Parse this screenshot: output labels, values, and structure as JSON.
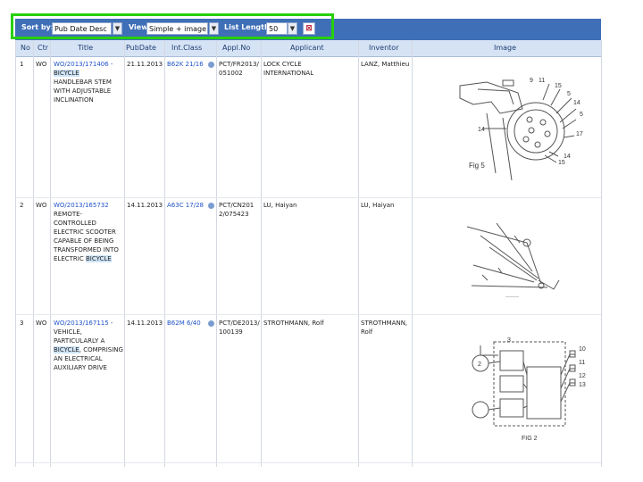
{
  "toolbar": {
    "sort_label": "Sort by:",
    "sort_value": "Pub Date Desc",
    "view_label": "View",
    "view_value": "Simple + image",
    "list_length_label": "List Length",
    "list_length_value": "50"
  },
  "columns": {
    "no": "No",
    "ctr": "Ctr",
    "title": "Title",
    "pubdate": "PubDate",
    "intclass": "Int.Class",
    "applno": "Appl.No",
    "applicant": "Applicant",
    "inventor": "Inventor",
    "image": "Image"
  },
  "rows": [
    {
      "no": "1",
      "ctr": "WO",
      "title_link": "WO/2013/171406 -",
      "title_keyword": "BICYCLE",
      "title_text": "HANDLEBAR STEM WITH ADJUSTABLE INCLINATION",
      "pubdate": "21.11.2013",
      "intclass": "B62K 21/16",
      "applno": "PCT/FR2013/051002",
      "applicant": "LOCK CYCLE INTERNATIONAL",
      "inventor": "LANZ, Matthieu",
      "image_caption": "Fig 5",
      "image_labels": [
        "9",
        "11",
        "15",
        "5",
        "14",
        "5",
        "17",
        "14",
        "14",
        "15"
      ]
    },
    {
      "no": "2",
      "ctr": "WO",
      "title_link": "WO/2013/165732",
      "title_text": "REMOTE-CONTROLLED ELECTRIC SCOOTER CAPABLE OF BEING TRANSFORMED INTO ELECTRIC",
      "title_keyword": "BICYCLE",
      "pubdate": "14.11.2013",
      "intclass": "A63C 17/28",
      "applno": "PCT/CN2012/075423",
      "applicant": "LU, Haiyan",
      "inventor": "LU, Haiyan"
    },
    {
      "no": "3",
      "ctr": "WO",
      "title_link": "WO/2013/167115 -",
      "title_text_pre": "VEHICLE, PARTICULARLY A",
      "title_keyword": "BICYCLE",
      "title_text": ", COMPRISING AN ELECTRICAL AUXILIARY DRIVE",
      "pubdate": "14.11.2013",
      "intclass": "B62M 6/40",
      "applno": "PCT/DE2013/100139",
      "applicant": "STROTHMANN, Rolf",
      "inventor": "STROTHMANN, Rolf",
      "image_caption": "FIG 2",
      "image_labels": [
        "3",
        "2",
        "10",
        "11",
        "12",
        "13"
      ]
    }
  ],
  "icons": {
    "filter": "filter-icon",
    "dropdown": "chevron-down-icon",
    "info": "info-icon"
  },
  "colors": {
    "toolbar_bg": "#3f6fb6",
    "header_bg": "#d6e3f4",
    "link": "#1f53c8",
    "keyword_highlight": "#cfe5f8",
    "annotation_box": "#27d00b"
  }
}
